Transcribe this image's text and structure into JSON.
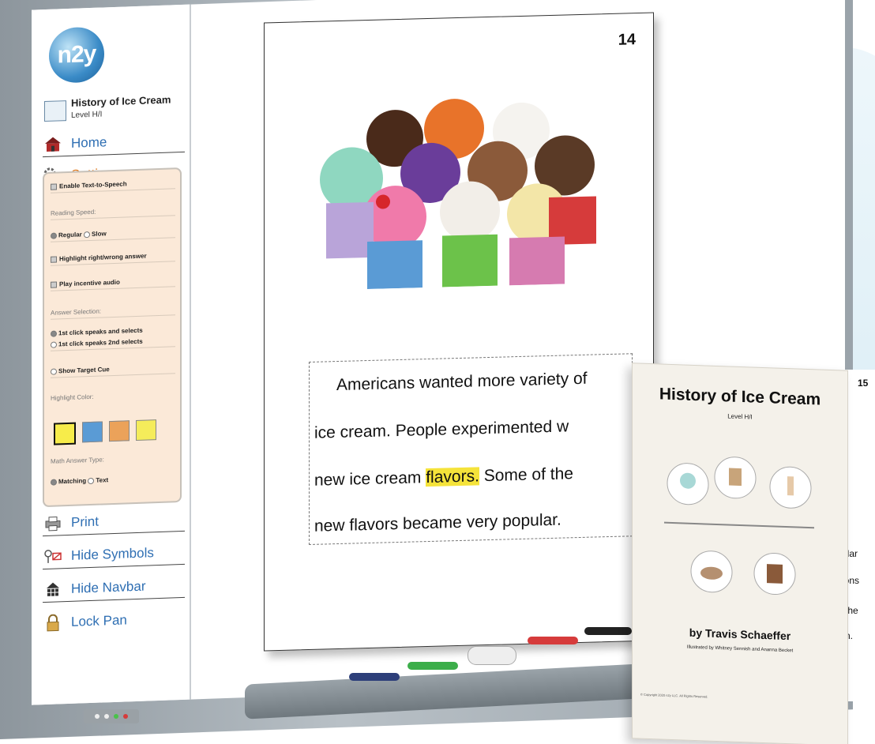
{
  "sidebar": {
    "logo_text": "n2y",
    "book_title": "History of Ice Cream",
    "book_level": "Level H/I",
    "nav": {
      "home": "Home",
      "settings": "Settings",
      "print": "Print",
      "hide_symbols": "Hide Symbols",
      "hide_navbar": "Hide Navbar",
      "lock_pan": "Lock Pan"
    },
    "settings_panel": {
      "enable_tts": "Enable Text-to-Speech",
      "reading_speed_caption": "Reading Speed:",
      "regular": "Regular",
      "slow": "Slow",
      "highlight_answer": "Highlight right/wrong answer",
      "incentive_audio": "Play incentive audio",
      "answer_selection_caption": "Answer Selection:",
      "first_click_selects": "1st click speaks and selects",
      "first_click_speaks": "1st click speaks 2nd selects",
      "show_target_cue": "Show Target Cue",
      "highlight_color_caption": "Highlight Color:",
      "math_answer_caption": "Math Answer Type:",
      "matching": "Matching",
      "text": "Text",
      "swatch_colors": [
        "#f7ec4a",
        "#5a9bd5",
        "#eba25a",
        "#f5ec5a"
      ]
    }
  },
  "page": {
    "number": "14",
    "lines": [
      "Americans wanted more variety of",
      "ice cream.  People experimented w",
      "new ice cream ",
      "flavors.",
      " Some of the",
      "new flavors became very popular."
    ],
    "highlight_color": "#f5e33a"
  },
  "cover": {
    "title": "History of Ice Cream",
    "level": "Level H/I",
    "author": "by Travis Schaeffer",
    "illustrators": "Illustrated by Whitney Sennish and Ananna Becket",
    "footer": "© Copyright 2020 n2y LLC. All Rights Reserved.",
    "next_page_number": "15",
    "next_page_snippets": [
      "ular",
      "ions",
      "the",
      "n."
    ]
  }
}
